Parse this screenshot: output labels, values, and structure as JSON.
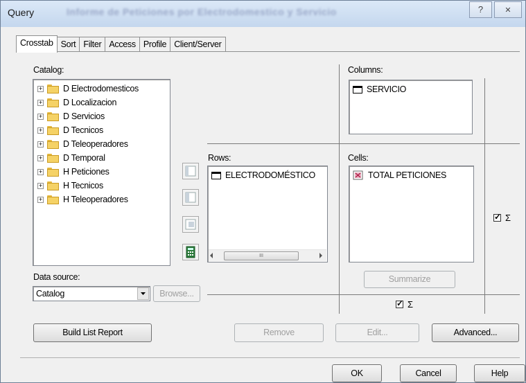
{
  "window": {
    "title": "Query",
    "blurred_title": "Informe de Peticiones por Electrodomestico y Servicio",
    "help_glyph": "?",
    "close_glyph": "✕"
  },
  "tabs": [
    "Crosstab",
    "Sort",
    "Filter",
    "Access",
    "Profile",
    "Client/Server"
  ],
  "catalog": {
    "label": "Catalog:",
    "items": [
      "D Electrodomesticos",
      "D Localizacion",
      "D Servicios",
      "D Tecnicos",
      "D Teleoperadores",
      "D Temporal",
      "H Peticiones",
      "H Tecnicos",
      "H Teleoperadores"
    ]
  },
  "columns": {
    "label": "Columns:",
    "items": [
      "SERVICIO"
    ]
  },
  "rows": {
    "label": "Rows:",
    "items": [
      "ELECTRODOMÉSTICO"
    ]
  },
  "cells": {
    "label": "Cells:",
    "items": [
      "TOTAL PETICIONES"
    ]
  },
  "data_source": {
    "label": "Data source:",
    "value": "Catalog",
    "browse_label": "Browse..."
  },
  "sigma": "Σ",
  "buttons": {
    "summarize": "Summarize",
    "build_list_report": "Build List Report",
    "remove": "Remove",
    "edit": "Edit...",
    "advanced": "Advanced...",
    "ok": "OK",
    "cancel": "Cancel",
    "help": "Help"
  },
  "scroll_thumb_grip": "III"
}
